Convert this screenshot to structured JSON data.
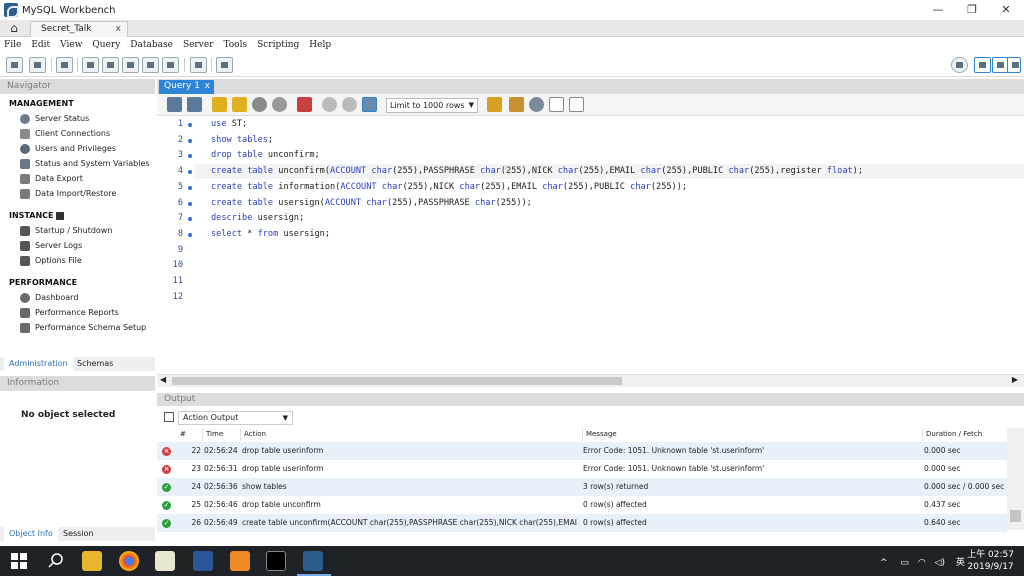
{
  "window": {
    "title": "MySQL Workbench",
    "minimize": "—",
    "maximize": "❐",
    "close": "✕"
  },
  "connection_tab": {
    "label": "Secret_Talk",
    "close": "x",
    "home_icon": "⌂"
  },
  "menu": [
    "File",
    "Edit",
    "View",
    "Query",
    "Database",
    "Server",
    "Tools",
    "Scripting",
    "Help"
  ],
  "navigator": {
    "header": "Navigator",
    "management": {
      "title": "MANAGEMENT",
      "items": [
        "Server Status",
        "Client Connections",
        "Users and Privileges",
        "Status and System Variables",
        "Data Export",
        "Data Import/Restore"
      ]
    },
    "instance": {
      "title": "INSTANCE",
      "items": [
        "Startup / Shutdown",
        "Server Logs",
        "Options File"
      ]
    },
    "performance": {
      "title": "PERFORMANCE",
      "items": [
        "Dashboard",
        "Performance Reports",
        "Performance Schema Setup"
      ]
    },
    "tabs": [
      "Administration",
      "Schemas"
    ]
  },
  "info": {
    "header": "Information",
    "message": "No object selected",
    "tabs": [
      "Object Info",
      "Session"
    ]
  },
  "query_tab": {
    "label": "Query 1",
    "close": "x"
  },
  "query_toolbar": {
    "limit": "Limit to 1000 rows"
  },
  "editor": {
    "lines": [
      {
        "n": "1",
        "code": [
          [
            "kw",
            "use"
          ],
          [
            "t",
            " ST;"
          ]
        ]
      },
      {
        "n": "2",
        "code": [
          [
            "kw",
            "show tables"
          ],
          [
            "t",
            ";"
          ]
        ]
      },
      {
        "n": "3",
        "code": [
          [
            "kw",
            "drop table"
          ],
          [
            "t",
            " unconfirm;"
          ]
        ]
      },
      {
        "n": "4",
        "code": [
          [
            "kw",
            "create table"
          ],
          [
            "t",
            " unconfirm("
          ],
          [
            "kw",
            "ACCOUNT"
          ],
          [
            "t",
            " "
          ],
          [
            "kw",
            "char"
          ],
          [
            "t",
            "(255),PASSPHRASE "
          ],
          [
            "kw",
            "char"
          ],
          [
            "t",
            "(255),NICK "
          ],
          [
            "kw",
            "char"
          ],
          [
            "t",
            "(255),EMAIL "
          ],
          [
            "kw",
            "char"
          ],
          [
            "t",
            "(255),PUBLIC "
          ],
          [
            "kw",
            "char"
          ],
          [
            "t",
            "(255),register "
          ],
          [
            "kw",
            "float"
          ],
          [
            "t",
            ");"
          ]
        ]
      },
      {
        "n": "5",
        "code": [
          [
            "kw",
            "create table"
          ],
          [
            "t",
            " information("
          ],
          [
            "kw",
            "ACCOUNT"
          ],
          [
            "t",
            " "
          ],
          [
            "kw",
            "char"
          ],
          [
            "t",
            "(255),NICK "
          ],
          [
            "kw",
            "char"
          ],
          [
            "t",
            "(255),EMAIL "
          ],
          [
            "kw",
            "char"
          ],
          [
            "t",
            "(255),PUBLIC "
          ],
          [
            "kw",
            "char"
          ],
          [
            "t",
            "(255));"
          ]
        ]
      },
      {
        "n": "6",
        "code": [
          [
            "kw",
            "create table"
          ],
          [
            "t",
            " usersign("
          ],
          [
            "kw",
            "ACCOUNT"
          ],
          [
            "t",
            " "
          ],
          [
            "kw",
            "char"
          ],
          [
            "t",
            "(255),PASSPHRASE "
          ],
          [
            "kw",
            "char"
          ],
          [
            "t",
            "(255));"
          ]
        ]
      },
      {
        "n": "7",
        "code": [
          [
            "kw",
            "describe"
          ],
          [
            "t",
            " usersign;"
          ]
        ]
      },
      {
        "n": "8",
        "code": [
          [
            "kw",
            "select"
          ],
          [
            "t",
            " * "
          ],
          [
            "kw",
            "from"
          ],
          [
            "t",
            " usersign;"
          ]
        ]
      },
      {
        "n": "9",
        "code": []
      },
      {
        "n": "10",
        "code": []
      },
      {
        "n": "11",
        "code": []
      },
      {
        "n": "12",
        "code": []
      }
    ]
  },
  "output": {
    "header": "Output",
    "selector": "Action Output",
    "columns": [
      "#",
      "Time",
      "Action",
      "Message",
      "Duration / Fetch"
    ],
    "rows": [
      {
        "status": "error",
        "num": "22",
        "time": "02:56:24",
        "action": "drop table userinform",
        "message": "Error Code: 1051. Unknown table 'st.userinform'",
        "duration": "0.000 sec"
      },
      {
        "status": "error",
        "num": "23",
        "time": "02:56:31",
        "action": "drop table userinform",
        "message": "Error Code: 1051. Unknown table 'st.userinform'",
        "duration": "0.000 sec"
      },
      {
        "status": "ok",
        "num": "24",
        "time": "02:56:36",
        "action": "show tables",
        "message": "3 row(s) returned",
        "duration": "0.000 sec / 0.000 sec"
      },
      {
        "status": "ok",
        "num": "25",
        "time": "02:56:46",
        "action": "drop table unconfirm",
        "message": "0 row(s) affected",
        "duration": "0.437 sec"
      },
      {
        "status": "ok",
        "num": "26",
        "time": "02:56:49",
        "action": "create table unconfirm(ACCOUNT char(255),PASSPHRASE char(255),NICK char(255),EMAI...",
        "message": "0 row(s) affected",
        "duration": "0.640 sec"
      }
    ]
  },
  "taskbar": {
    "clock_time": "上午 02:57",
    "clock_date": "2019/9/17",
    "ime": "英",
    "tray": "^"
  },
  "colors": {
    "accent": "#2d84d6",
    "error": "#d43a3a",
    "ok": "#2e9e3a",
    "taskbar": "#1f2328"
  }
}
